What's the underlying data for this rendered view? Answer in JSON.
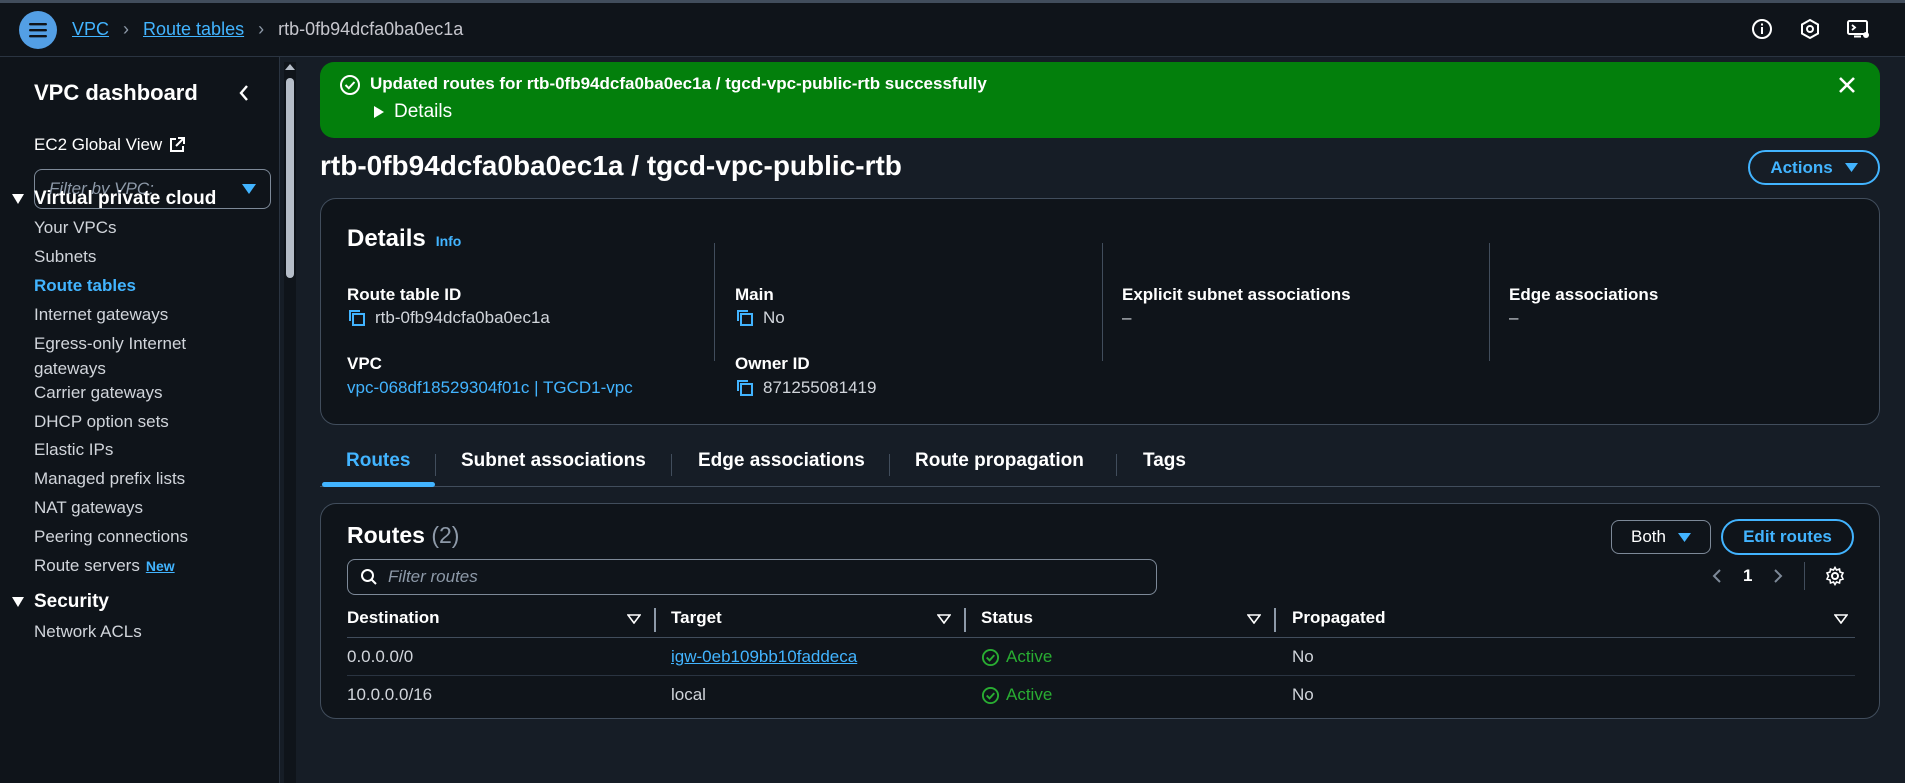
{
  "breadcrumb": {
    "root": "VPC",
    "parent": "Route tables",
    "current": "rtb-0fb94dcfa0ba0ec1a"
  },
  "sidebar": {
    "title": "VPC dashboard",
    "global_view": "EC2 Global View",
    "filter_placeholder": "Filter by VPC:",
    "section_vpc": "Virtual private cloud",
    "items": [
      "Your VPCs",
      "Subnets",
      "Route tables",
      "Internet gateways",
      "Egress-only Internet gateways",
      "Carrier gateways",
      "DHCP option sets",
      "Elastic IPs",
      "Managed prefix lists",
      "NAT gateways",
      "Peering connections",
      "Route servers"
    ],
    "new_badge": "New",
    "section_security": "Security",
    "security_items": [
      "Network ACLs"
    ]
  },
  "flash": {
    "message": "Updated routes for rtb-0fb94dcfa0ba0ec1a / tgcd-vpc-public-rtb successfully",
    "details_label": "Details"
  },
  "page": {
    "title": "rtb-0fb94dcfa0ba0ec1a / tgcd-vpc-public-rtb",
    "actions_label": "Actions"
  },
  "details": {
    "heading": "Details",
    "info": "Info",
    "route_table_id_label": "Route table ID",
    "route_table_id": "rtb-0fb94dcfa0ba0ec1a",
    "main_label": "Main",
    "main_value": "No",
    "explicit_label": "Explicit subnet associations",
    "explicit_value": "–",
    "edge_label": "Edge associations",
    "edge_value": "–",
    "vpc_label": "VPC",
    "vpc_value": "vpc-068df18529304f01c | TGCD1-vpc",
    "owner_label": "Owner ID",
    "owner_value": "871255081419"
  },
  "tabs": [
    "Routes",
    "Subnet associations",
    "Edge associations",
    "Route propagation",
    "Tags"
  ],
  "routes": {
    "heading": "Routes",
    "count": "(2)",
    "both_label": "Both",
    "edit_label": "Edit routes",
    "filter_placeholder": "Filter routes",
    "page": "1",
    "columns": [
      "Destination",
      "Target",
      "Status",
      "Propagated"
    ],
    "rows": [
      {
        "destination": "0.0.0.0/0",
        "target": "igw-0eb109bb10faddeca",
        "status": "Active",
        "propagated": "No"
      },
      {
        "destination": "10.0.0.0/16",
        "target": "local",
        "status": "Active",
        "propagated": "No"
      }
    ]
  },
  "colors": {
    "accent": "#42b4ff",
    "success_bg": "#037f0c",
    "status_ok": "#29ad32"
  }
}
